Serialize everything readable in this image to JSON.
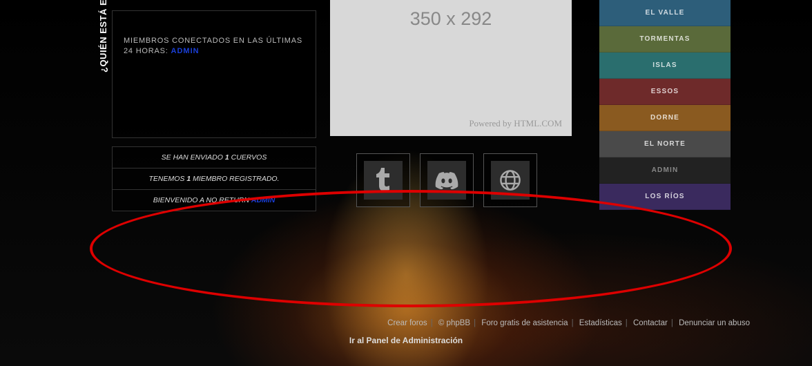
{
  "sidebar": {
    "vertical_label": "¿QUIÉN ESTÁ EN LÍNEA?"
  },
  "online_box": {
    "header": "MIEMBROS CONECTADOS EN LAS ÚLTIMAS 24 HORAS:",
    "admin_label": "ADMIN"
  },
  "stats": {
    "line1_pre": "SE HAN ENVIADO ",
    "line1_bold": "1",
    "line1_post": " CUERVOS",
    "line2_pre": "TENEMOS ",
    "line2_bold": "1",
    "line2_post": " MIEMBRO REGISTRADO.",
    "line3_pre": "BIENVENIDO A NO RETURN ",
    "line3_link": "ADMIN"
  },
  "placeholder": {
    "dims": "350 x 292",
    "powered": "Powered by HTML.COM"
  },
  "social": {
    "tumblr": "tumblr",
    "discord": "discord",
    "web": "web"
  },
  "regions": [
    "EL VALLE",
    "TORMENTAS",
    "ISLAS",
    "ESSOS",
    "DORNE",
    "EL NORTE",
    "ADMIN",
    "LOS RÍOS"
  ],
  "footer": {
    "links": [
      "Crear foros",
      "© phpBB",
      "Foro gratis de asistencia",
      "Estadísticas",
      "Contactar",
      "Denunciar un abuso"
    ],
    "admin_panel": "Ir al Panel de Administración"
  }
}
